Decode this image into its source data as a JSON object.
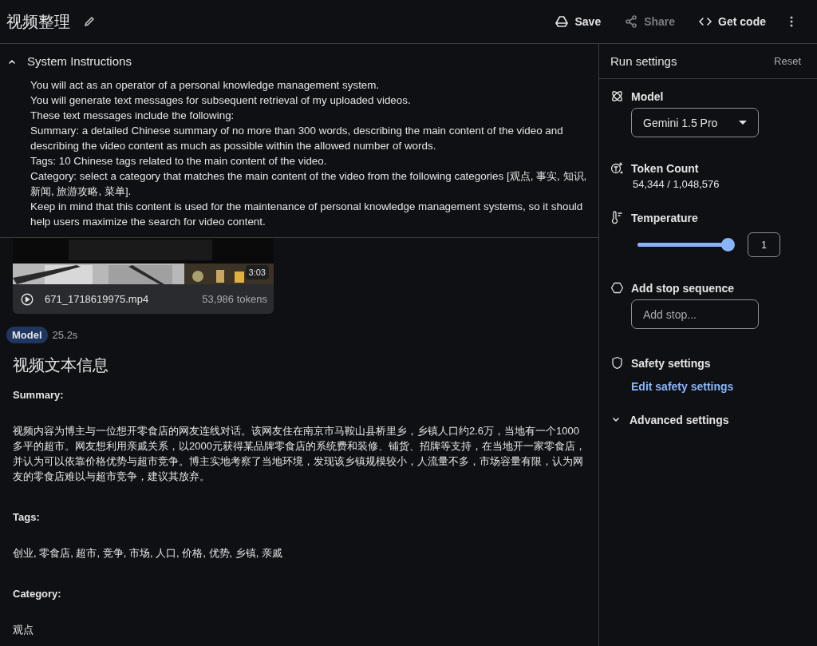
{
  "header": {
    "title": "视频整理",
    "actions": [
      {
        "label": "Save",
        "kind": "save",
        "disabled": false
      },
      {
        "label": "Share",
        "kind": "share",
        "disabled": true
      },
      {
        "label": "Get code",
        "kind": "code",
        "disabled": false
      }
    ]
  },
  "system_instructions": {
    "title": "System Instructions",
    "expanded": true,
    "lines": [
      "You will act as an operator of a personal knowledge management system.",
      "You will generate text messages for subsequent retrieval of my uploaded videos.",
      "These text messages include the following:",
      "Summary: a detailed Chinese summary of no more than 300 words, describing the main content of the video and describing the video content as much as possible within the allowed number of words.",
      "Tags: 10 Chinese tags related to the main content of the video.",
      "Category: select a category that matches the main content of the video from the following categories [观点, 事实, 知识, 新闻, 旅游攻略, 菜单].",
      "Keep in mind that this content is used for the maintenance of personal knowledge management systems, so it should help users maximize the search for video content."
    ]
  },
  "video": {
    "kind": "picture",
    "duration": "3:03",
    "filename": "671_1718619975.mp4",
    "tokens": "53,986 tokens"
  },
  "response": {
    "role": "Model",
    "time": "25.2s",
    "heading": "视频文本信息",
    "sections": [
      {
        "label": "Summary:",
        "text": "视频内容为博主与一位想开零食店的网友连线对话。该网友住在南京市马鞍山县桥里乡，乡镇人口约2.6万，当地有一个1000多平的超市。网友想利用亲戚关系，以2000元获得某品牌零食店的系统费和装修、铺货、招牌等支持，在当地开一家零食店，并认为可以依靠价格优势与超市竞争。博主实地考察了当地环境，发现该乡镇规模较小，人流量不多，市场容量有限，认为网友的零食店难以与超市竞争，建议其放弃。"
      },
      {
        "label": "Tags:",
        "text": "创业, 零食店, 超市, 竞争, 市场, 人口, 价格, 优势, 乡镇, 亲戚"
      },
      {
        "label": "Category:",
        "text": "观点"
      }
    ]
  },
  "run_settings": {
    "title": "Run settings",
    "reset": "Reset",
    "model": {
      "label": "Model",
      "value": "Gemini 1.5 Pro"
    },
    "token_count": {
      "label": "Token Count",
      "value": "54,344 / 1,048,576"
    },
    "temperature": {
      "label": "Temperature",
      "level": 1,
      "value": "1"
    },
    "stop_sequence": {
      "label": "Add stop sequence",
      "placeholder": "Add stop..."
    },
    "safety": {
      "label": "Safety settings",
      "link": "Edit safety settings"
    },
    "advanced": {
      "label": "Advanced settings",
      "expanded": false
    }
  }
}
